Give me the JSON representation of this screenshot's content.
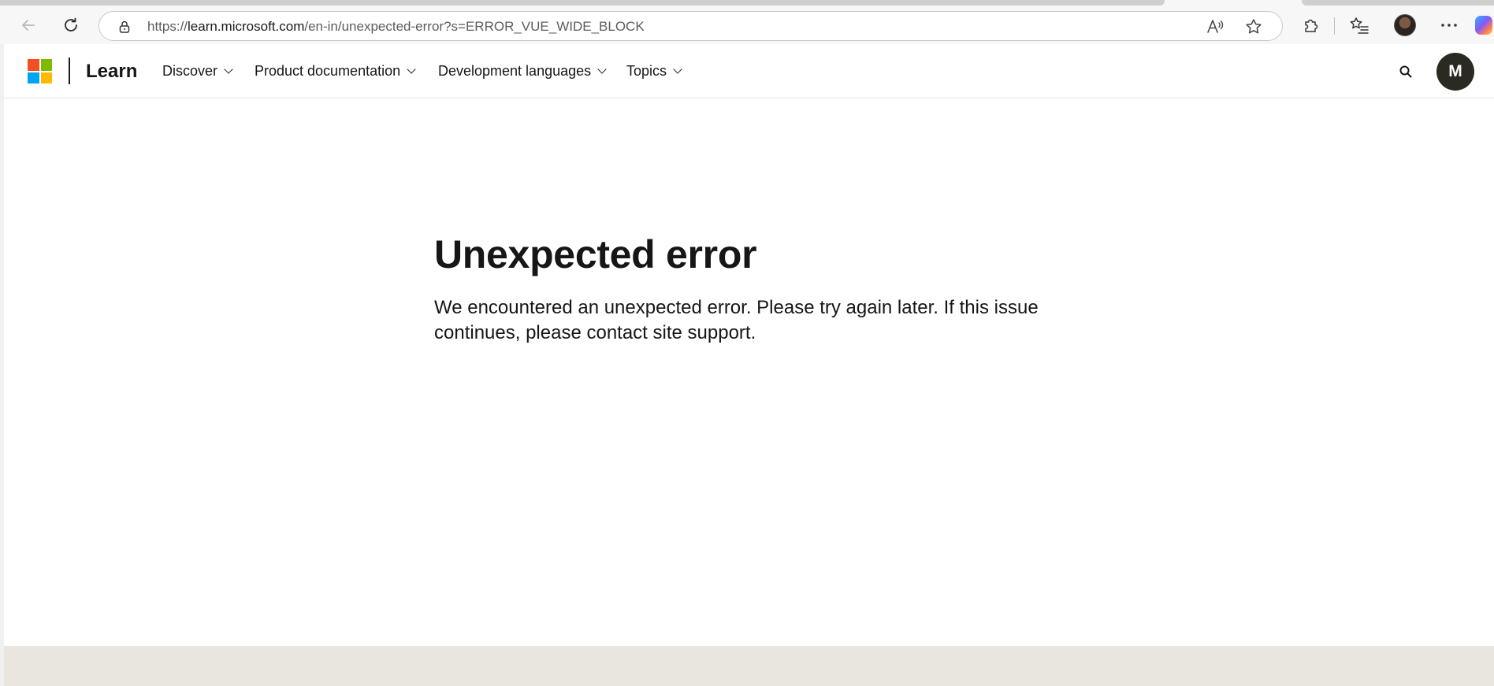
{
  "browser": {
    "url_prefix": "https://",
    "url_host": "learn.microsoft.com",
    "url_path": "/en-in/unexpected-error?s=ERROR_VUE_WIDE_BLOCK",
    "icons": {
      "back": "back-arrow-icon",
      "refresh": "refresh-icon",
      "site_info": "lock-icon",
      "read_aloud": "read-aloud-icon",
      "favorite": "star-icon",
      "extensions": "puzzle-icon",
      "favorites": "favorites-list-icon",
      "profile": "profile-picture",
      "more": "more-ellipsis-icon",
      "copilot": "copilot-icon"
    }
  },
  "header": {
    "brand": "Learn",
    "logo_colors": [
      "#f25022",
      "#7fba00",
      "#00a4ef",
      "#ffb900"
    ],
    "nav": [
      {
        "label": "Discover"
      },
      {
        "label": "Product documentation"
      },
      {
        "label": "Development languages"
      },
      {
        "label": "Topics"
      }
    ],
    "avatar_initial": "M",
    "avatar_color": "#2a2a22"
  },
  "main": {
    "title": "Unexpected error",
    "message": "We encountered an unexpected error. Please try again later. If this issue continues, please contact site support."
  },
  "colors": {
    "footer_band": "#e8e6df",
    "text": "#161616"
  }
}
